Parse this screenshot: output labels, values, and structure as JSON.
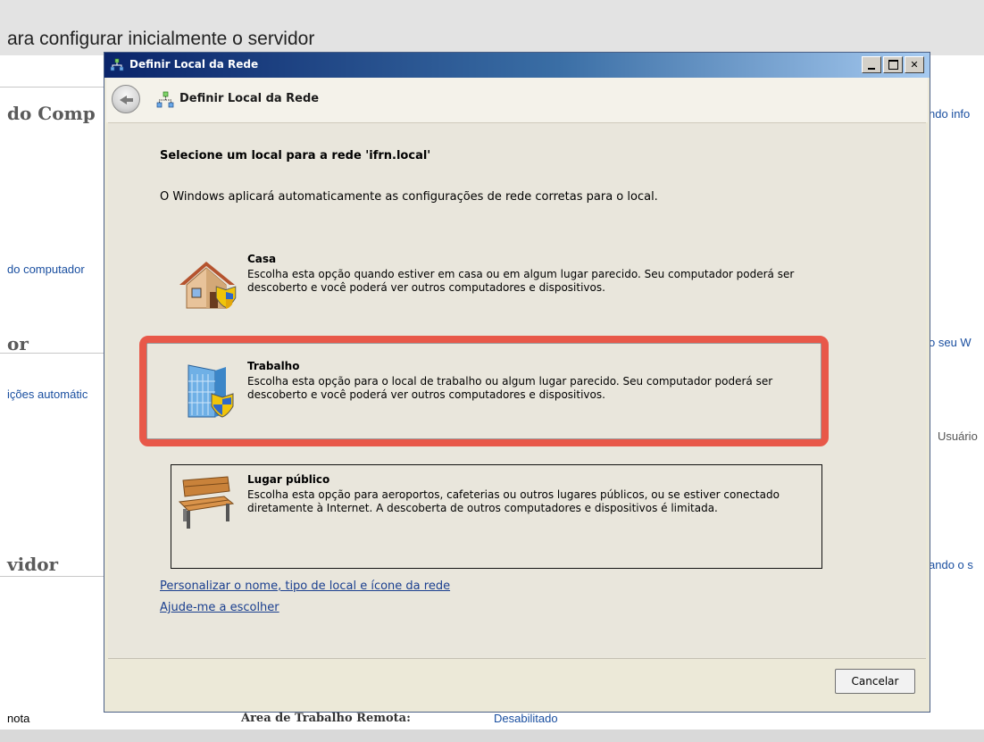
{
  "background": {
    "title": "ara configurar inicialmente o servidor",
    "section_1": "do Comp",
    "section_2": "or",
    "section_3": "vidor",
    "left_link_1": "do computador",
    "left_link_2": "ições automátic",
    "right_link_1": "ndo info",
    "right_link_2": "o seu W",
    "right_link_3": "Usuário",
    "right_link_4": "ando o s",
    "bottom_left": "nota",
    "bottom_label": "Área de Trabalho Remota:",
    "bottom_value": "Desabilitado"
  },
  "dialog": {
    "window_title": "Definir Local da Rede",
    "header_title": "Definir Local da Rede",
    "heading": "Selecione um local para a rede 'ifrn.local'",
    "subtext": "O Windows aplicará automaticamente as configurações de rede corretas para o local.",
    "options": [
      {
        "title": "Casa",
        "description": "Escolha esta opção quando estiver em casa ou em algum lugar parecido. Seu computador poderá ser descoberto e você poderá ver outros computadores e dispositivos.",
        "icon": "house-icon"
      },
      {
        "title": "Trabalho",
        "description": "Escolha esta opção para o local de trabalho ou algum lugar parecido. Seu computador poderá ser descoberto e você poderá ver outros computadores e dispositivos.",
        "icon": "office-building-icon"
      },
      {
        "title": "Lugar público",
        "description": "Escolha esta opção para aeroportos, cafeterias ou outros lugares públicos, ou se estiver conectado diretamente à Internet. A descoberta de outros computadores e dispositivos é limitada.",
        "icon": "bench-icon"
      }
    ],
    "link_customize": "Personalizar o nome, tipo de local e ícone da rede",
    "link_help": "Ajude-me a escolher",
    "cancel_label": "Cancelar"
  },
  "colors": {
    "highlight": "#e74c3c",
    "link": "#1a3f8f",
    "titlebar_start": "#0a246a",
    "titlebar_end": "#a6caf0"
  }
}
